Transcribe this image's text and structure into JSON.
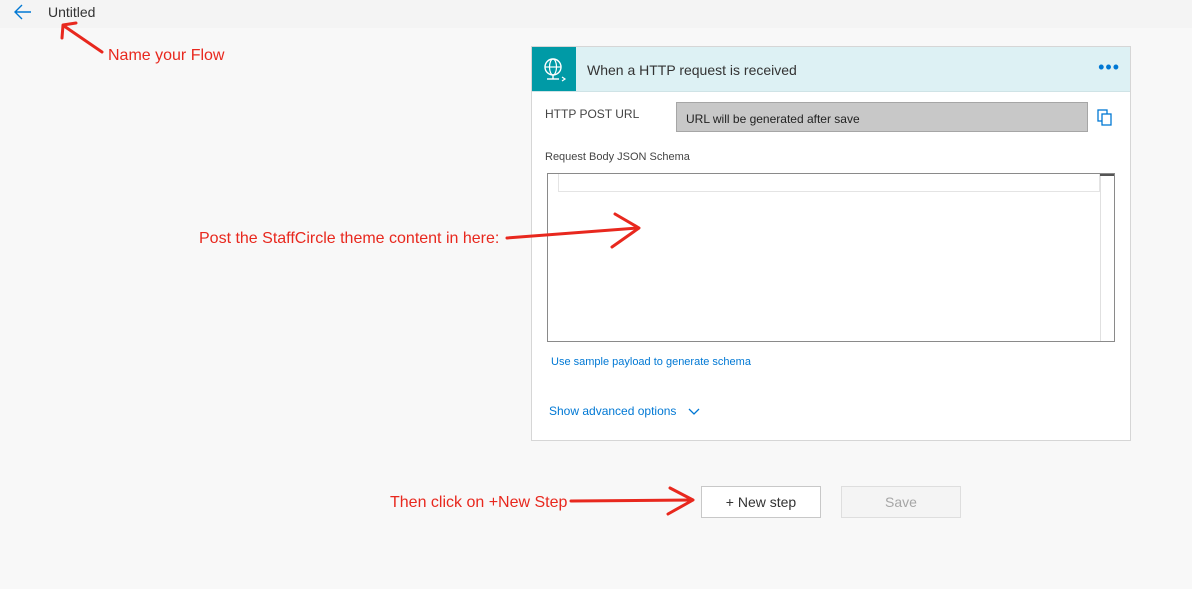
{
  "header": {
    "title": "Untitled",
    "back_icon": "arrow-left-icon"
  },
  "trigger_card": {
    "title": "When a HTTP request is received",
    "icon": "globe-network-icon",
    "more_label": "•••",
    "http_post_url_label": "HTTP POST URL",
    "http_post_url_value": "URL will be generated after save",
    "copy_icon": "copy-icon",
    "schema_label": "Request Body JSON Schema",
    "schema_value": "",
    "sample_payload_link": "Use sample payload to generate schema",
    "advanced_options_link": "Show advanced options"
  },
  "actions": {
    "new_step_label": "+ New step",
    "save_label": "Save"
  },
  "annotations": {
    "name_flow": "Name your Flow",
    "post_content": "Post the StaffCircle theme content in here:",
    "click_new_step": "Then click on +New Step",
    "color": "#e8281e"
  },
  "colors": {
    "accent": "#0078d4",
    "trigger_icon_bg": "#009aa6",
    "card_header_bg": "#ddf1f4"
  }
}
